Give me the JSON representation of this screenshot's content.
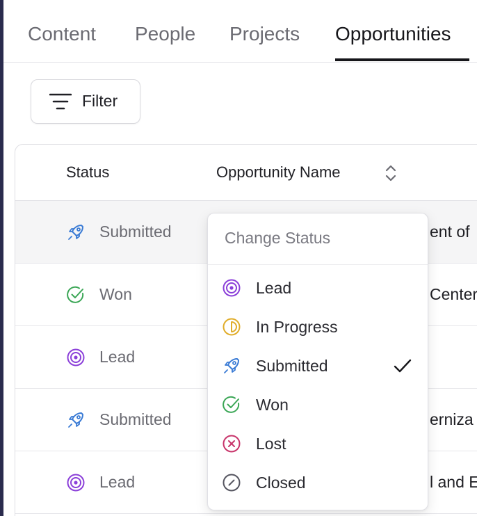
{
  "tabs": [
    {
      "label": "Content"
    },
    {
      "label": "People"
    },
    {
      "label": "Projects"
    },
    {
      "label": "Opportunities"
    }
  ],
  "active_tab": "Opportunities",
  "filter": {
    "label": "Filter"
  },
  "table": {
    "columns": {
      "status": "Status",
      "name": "Opportunity Name"
    },
    "rows": [
      {
        "status": "Submitted",
        "status_icon": "rocket-icon",
        "name": "ent of"
      },
      {
        "status": "Won",
        "status_icon": "check-circle-icon",
        "name": "Center"
      },
      {
        "status": "Lead",
        "status_icon": "target-icon",
        "name": ""
      },
      {
        "status": "Submitted",
        "status_icon": "rocket-icon",
        "name": "erniza"
      },
      {
        "status": "Lead",
        "status_icon": "target-icon",
        "name": "l and E"
      }
    ]
  },
  "dropdown": {
    "header": "Change Status",
    "items": [
      {
        "label": "Lead",
        "icon": "target-icon"
      },
      {
        "label": "In Progress",
        "icon": "half-circle-icon"
      },
      {
        "label": "Submitted",
        "icon": "rocket-icon",
        "selected": true
      },
      {
        "label": "Won",
        "icon": "check-circle-icon"
      },
      {
        "label": "Lost",
        "icon": "x-circle-icon"
      },
      {
        "label": "Closed",
        "icon": "slash-circle-icon"
      }
    ]
  },
  "colors": {
    "lead": "#8b3fd9",
    "in_progress": "#e0ad2a",
    "submitted": "#3a7bd5",
    "won": "#3aa655",
    "lost": "#c8356b",
    "closed": "#555560",
    "left_rail": "#2a2b4d"
  }
}
